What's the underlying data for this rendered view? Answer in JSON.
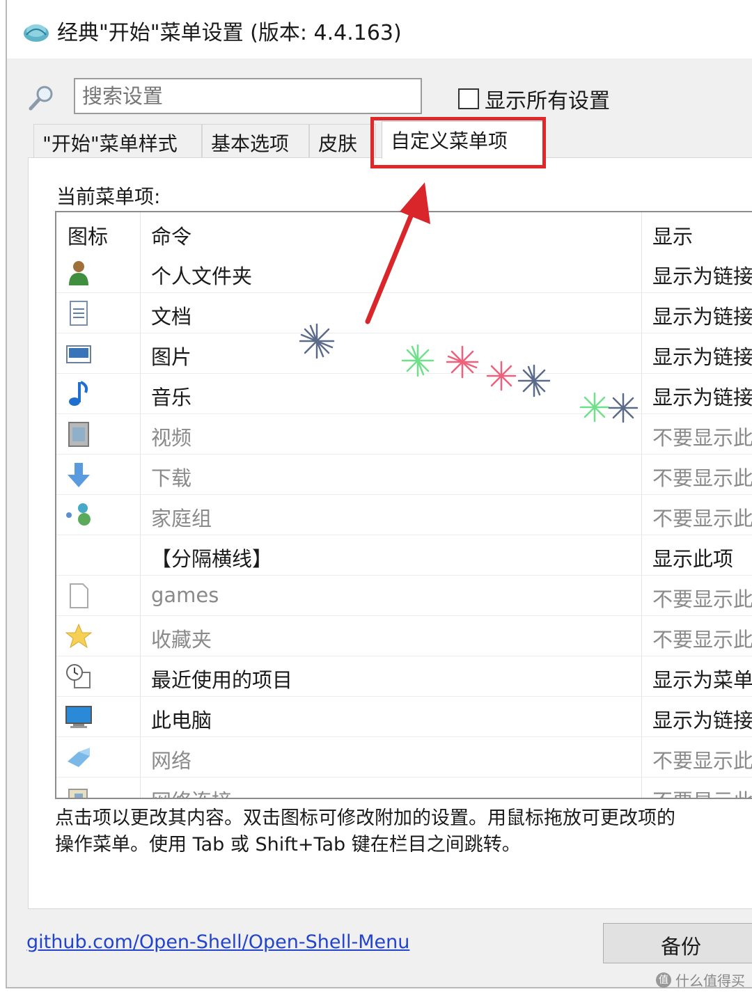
{
  "window": {
    "title": "经典\"开始\"菜单设置 (版本: 4.4.163)"
  },
  "search": {
    "placeholder": "搜索设置",
    "show_all_label": "显示所有设置"
  },
  "tabs": [
    {
      "label": "\"开始\"菜单样式",
      "active": false
    },
    {
      "label": "基本选项",
      "active": false
    },
    {
      "label": "皮肤",
      "active": false
    },
    {
      "label": "自定义菜单项",
      "active": true
    }
  ],
  "panel": {
    "current_label": "当前菜单项:",
    "columns": {
      "icon": "图标",
      "command": "命令",
      "display": "显示"
    },
    "rows": [
      {
        "icon": "user-icon",
        "command": "个人文件夹",
        "display": "显示为链接",
        "dim": false
      },
      {
        "icon": "document-icon",
        "command": "文档",
        "display": "显示为链接",
        "dim": false
      },
      {
        "icon": "picture-icon",
        "command": "图片",
        "display": "显示为链接",
        "dim": false
      },
      {
        "icon": "music-note-icon",
        "command": "音乐",
        "display": "显示为链接",
        "dim": false
      },
      {
        "icon": "video-icon",
        "command": "视频",
        "display": "不要显示此",
        "dim": true
      },
      {
        "icon": "download-arrow-icon",
        "command": "下载",
        "display": "不要显示此",
        "dim": true
      },
      {
        "icon": "homegroup-icon",
        "command": "家庭组",
        "display": "不要显示此",
        "dim": true
      },
      {
        "icon": "",
        "command": "【分隔横线】",
        "display": "显示此项",
        "dim": false
      },
      {
        "icon": "blank-file-icon",
        "command": "games",
        "display": "不要显示此",
        "dim": true
      },
      {
        "icon": "star-icon",
        "command": "收藏夹",
        "display": "不要显示此",
        "dim": true
      },
      {
        "icon": "recent-items-icon",
        "command": "最近使用的项目",
        "display": "显示为菜单",
        "dim": false
      },
      {
        "icon": "monitor-icon",
        "command": "此电脑",
        "display": "显示为链接",
        "dim": false
      },
      {
        "icon": "network-icon",
        "command": "网络",
        "display": "不要显示此",
        "dim": true
      },
      {
        "icon": "network-connection-icon",
        "command": "网络连接",
        "display": "不要显示此",
        "dim": true
      }
    ],
    "hint_line1": "点击项以更改其内容。双击图标可修改附加的设置。用鼠标拖放可更改项的",
    "hint_line2": "操作菜单。使用 Tab 或 Shift+Tab 键在栏目之间跳转。"
  },
  "footer": {
    "link": "github.com/Open-Shell/Open-Shell-Menu",
    "backup_label": "备份"
  },
  "watermark": {
    "text": "什么值得买",
    "badge": "值"
  },
  "colors": {
    "highlight_box": "#e0282b",
    "link": "#2244cc",
    "dim_text": "#8a8a8a"
  }
}
